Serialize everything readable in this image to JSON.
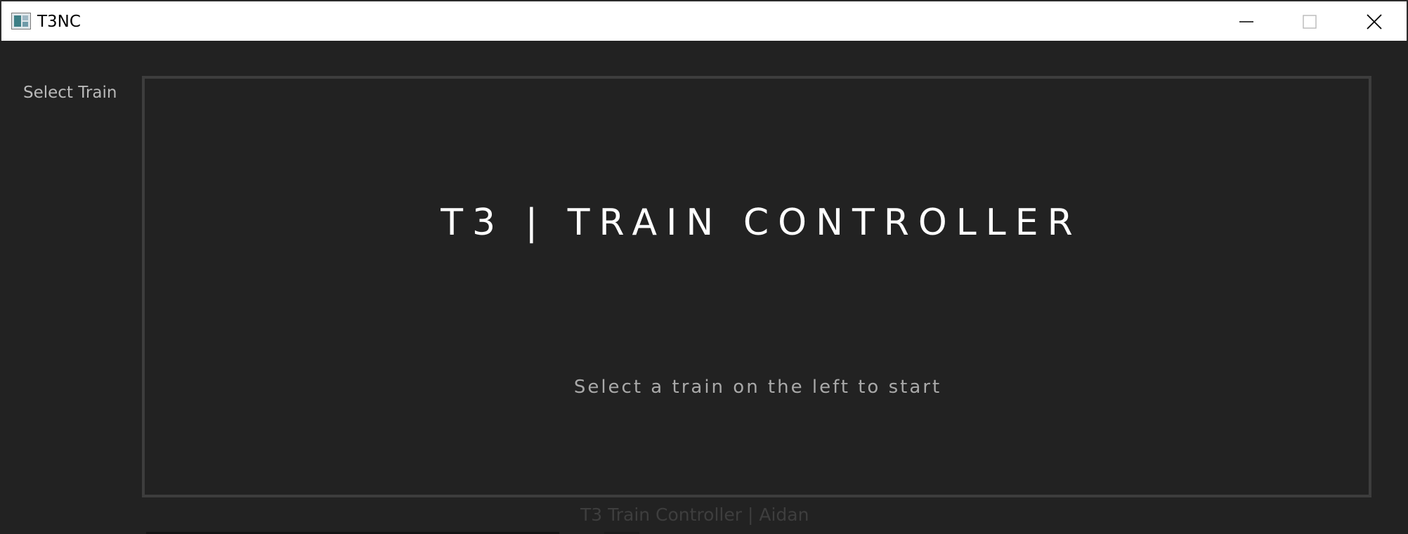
{
  "window": {
    "title": "T3NC",
    "controls": {
      "minimize_icon": "minimize-icon",
      "maximize_icon": "maximize-icon",
      "close_icon": "close-icon"
    }
  },
  "sidebar": {
    "label": "Select Train",
    "items": []
  },
  "main": {
    "title": "T3 | TRAIN CONTROLLER",
    "subtitle": "Select a train on the left to start"
  },
  "footer": {
    "text": "T3 Train Controller | Aidan"
  },
  "colors": {
    "background": "#222222",
    "panel_border": "#3d3d3d",
    "title_text": "#ffffff",
    "subtitle_text": "#a9a9a9",
    "sidebar_text": "#b9b9b9",
    "footer_text": "#3e3e3e"
  }
}
